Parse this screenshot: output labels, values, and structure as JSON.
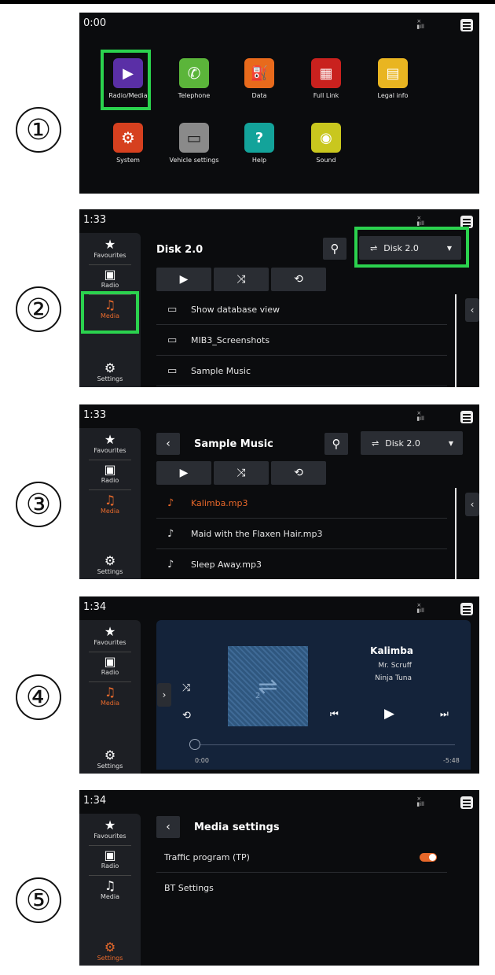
{
  "steps": [
    "①",
    "②",
    "③",
    "④",
    "⑤"
  ],
  "status": {
    "signal": "×\n▯all"
  },
  "screen1": {
    "time": "0:00",
    "apps": [
      {
        "label": "Radio/Media",
        "icon": "play-icon",
        "glyph": "▶",
        "color": "#5a2fa6"
      },
      {
        "label": "Telephone",
        "icon": "phone-icon",
        "glyph": "✆",
        "color": "#5bb53a"
      },
      {
        "label": "Data",
        "icon": "data-icon",
        "glyph": "⛽",
        "color": "#e86a1c"
      },
      {
        "label": "Full Link",
        "icon": "full-link-icon",
        "glyph": "▦",
        "color": "#c9211e"
      },
      {
        "label": "Legal info",
        "icon": "legal-icon",
        "glyph": "▤",
        "color": "#e9b521"
      },
      {
        "label": "System",
        "icon": "gear-icon",
        "glyph": "⚙",
        "color": "#d6401f"
      },
      {
        "label": "Vehicle settings",
        "icon": "car-icon",
        "glyph": "▭",
        "color": "#8a8a8a"
      },
      {
        "label": "Help",
        "icon": "help-icon",
        "glyph": "?",
        "color": "#13a39a"
      },
      {
        "label": "Sound",
        "icon": "sound-icon",
        "glyph": "◉",
        "color": "#c9c71e"
      }
    ]
  },
  "sidebar": {
    "favourites": "Favourites",
    "radio": "Radio",
    "media": "Media",
    "settings": "Settings"
  },
  "screen2": {
    "time": "1:33",
    "title": "Disk 2.0",
    "disk": "Disk 2.0",
    "rows": [
      "Show database view",
      "MIB3_Screenshots",
      "Sample Music"
    ]
  },
  "screen3": {
    "time": "1:33",
    "title": "Sample Music",
    "disk": "Disk 2.0",
    "rows": [
      "Kalimba.mp3",
      "Maid with the Flaxen Hair.mp3",
      "Sleep Away.mp3"
    ]
  },
  "screen4": {
    "time": "1:34",
    "track": "Kalimba",
    "artist": "Mr. Scruff",
    "album": "Ninja Tuna",
    "elapsed": "0:00",
    "remaining": "-5:48",
    "art_label": "2",
    "progress": 0
  },
  "screen5": {
    "time": "1:34",
    "title": "Media settings",
    "rows": [
      "Traffic program (TP)",
      "BT Settings"
    ],
    "tp_enabled": true
  },
  "colors": {
    "accent": "#e86a2c",
    "highlight": "#2bd24e",
    "bg": "#0b0c0e"
  }
}
